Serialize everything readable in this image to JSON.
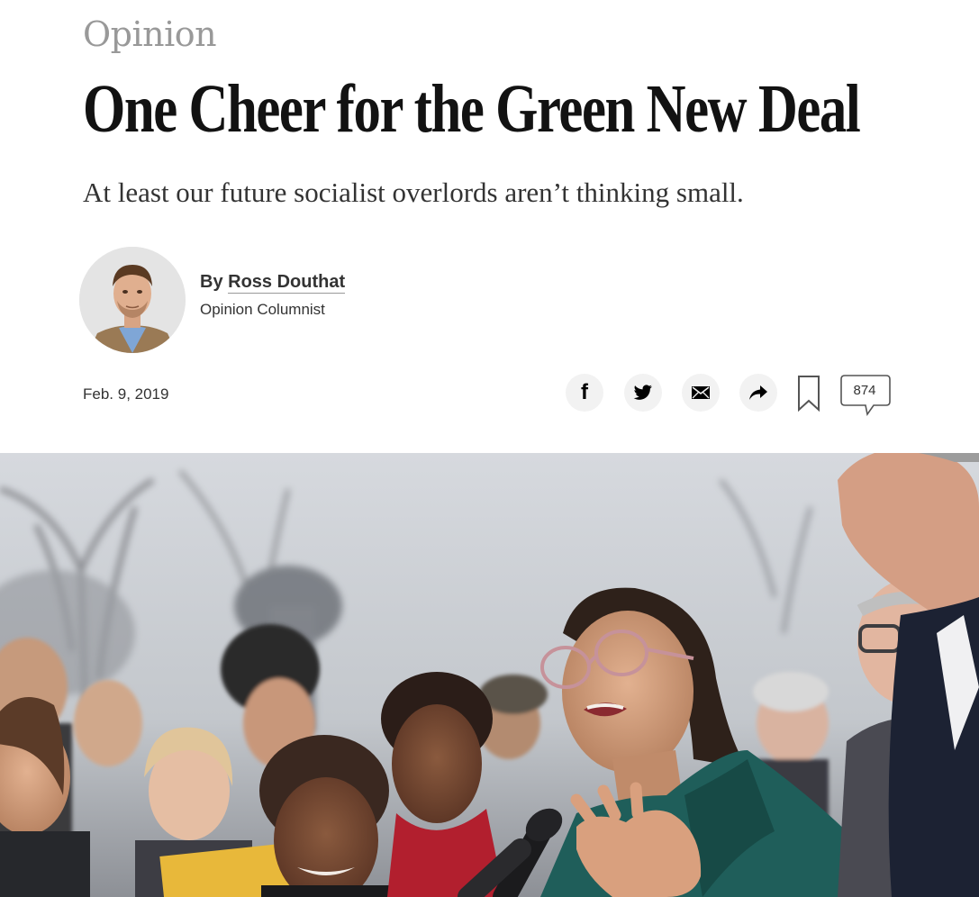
{
  "section": {
    "kicker": "Opinion"
  },
  "article": {
    "headline": "One Cheer for the Green New Deal",
    "summary": "At least our future socialist overlords aren’t thinking small.",
    "date": "Feb. 9, 2019"
  },
  "byline": {
    "prefix": "By ",
    "author": "Ross Douthat",
    "role": "Opinion Columnist"
  },
  "share": {
    "facebook_icon": "facebook-icon",
    "twitter_icon": "twitter-icon",
    "email_icon": "email-icon",
    "more_icon": "share-arrow-icon",
    "bookmark_icon": "bookmark-icon",
    "comment_count": "874"
  }
}
